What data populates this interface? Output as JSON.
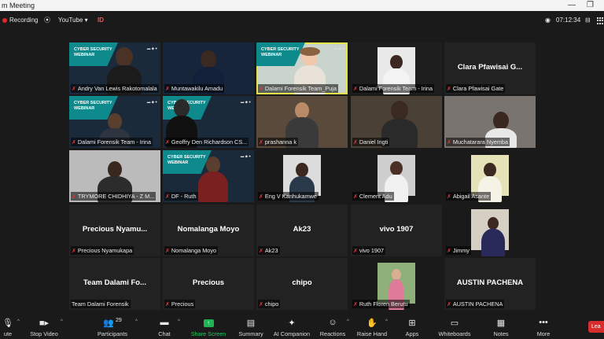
{
  "window": {
    "title": "m Meeting"
  },
  "topbar": {
    "recording_label": "Recording",
    "youtube_label": "YouTube",
    "id_label": "ID",
    "time": "07:12:34"
  },
  "tiles": [
    {
      "label": "Andry Van Lewis Rakotomalala",
      "big": "",
      "type": "banner-person"
    },
    {
      "label": "Muntawakilu Amadu",
      "big": "",
      "type": "dark-person"
    },
    {
      "label": "Dalami Forensik Team_Puja",
      "big": "",
      "type": "banner-woman",
      "active": true
    },
    {
      "label": "Dalami Forensik Team - Irina",
      "big": "",
      "type": "photo-person"
    },
    {
      "label": "Clara Pfawisai Gate",
      "big": "Clara Pfawisai G...",
      "type": "name"
    },
    {
      "label": "Dalami Forensik Team - Irina",
      "big": "",
      "type": "banner-person2"
    },
    {
      "label": "Geoffry Den Richardson CS...",
      "big": "",
      "type": "banner-dark"
    },
    {
      "label": "prashanna k",
      "big": "",
      "type": "room-person"
    },
    {
      "label": "Daniel Ingti",
      "big": "",
      "type": "room-person2"
    },
    {
      "label": "Muchatarara Nyemba",
      "big": "",
      "type": "room-person3"
    },
    {
      "label": "TRYMORE CHIDHIYA - Z M...",
      "big": "",
      "type": "grey-person"
    },
    {
      "label": "DF - Ruth",
      "big": "",
      "type": "banner-woman2"
    },
    {
      "label": "Eng V Kanhukamwe",
      "big": "",
      "type": "photo-small"
    },
    {
      "label": "Clement Adu",
      "big": "",
      "type": "photo-small2"
    },
    {
      "label": "Abigail Asante",
      "big": "",
      "type": "photo-small3"
    },
    {
      "label": "Precious Nyamukapa",
      "big": "Precious Nyamu...",
      "type": "name"
    },
    {
      "label": "Nomalanga Moyo",
      "big": "Nomalanga Moyo",
      "type": "name"
    },
    {
      "label": "Ak23",
      "big": "Ak23",
      "type": "name"
    },
    {
      "label": "vivo 1907",
      "big": "vivo 1907",
      "type": "name"
    },
    {
      "label": "Jimmy",
      "big": "",
      "type": "photo-small4"
    },
    {
      "label": "Team Dalami Forensik",
      "big": "Team Dalami Fo...",
      "type": "name",
      "nomic": true
    },
    {
      "label": "Precious",
      "big": "Precious",
      "type": "name"
    },
    {
      "label": "chipo",
      "big": "chipo",
      "type": "name"
    },
    {
      "label": "Ruth Floren Berutu",
      "big": "",
      "type": "photo-small5"
    },
    {
      "label": "AUSTIN PACHENA",
      "big": "AUSTIN PACHENA",
      "type": "name"
    }
  ],
  "banner": {
    "line1": "CYBER SECURITY",
    "line2": "WEBINAR"
  },
  "toolbar": {
    "audio": "ute",
    "video": "Stop Video",
    "participants": "Participants",
    "participants_count": "29",
    "chat": "Chat",
    "share": "Share Screen",
    "summary": "Summary",
    "companion": "AI Companion",
    "reactions": "Reactions",
    "raise": "Raise Hand",
    "apps": "Apps",
    "whiteboards": "Whiteboards",
    "notes": "Notes",
    "more": "More",
    "leave": "Lea"
  },
  "colors": {
    "accent_green": "#1fb356",
    "record_red": "#e02828",
    "active_border": "#e2e44a",
    "banner_teal": "#0e8a8c"
  }
}
